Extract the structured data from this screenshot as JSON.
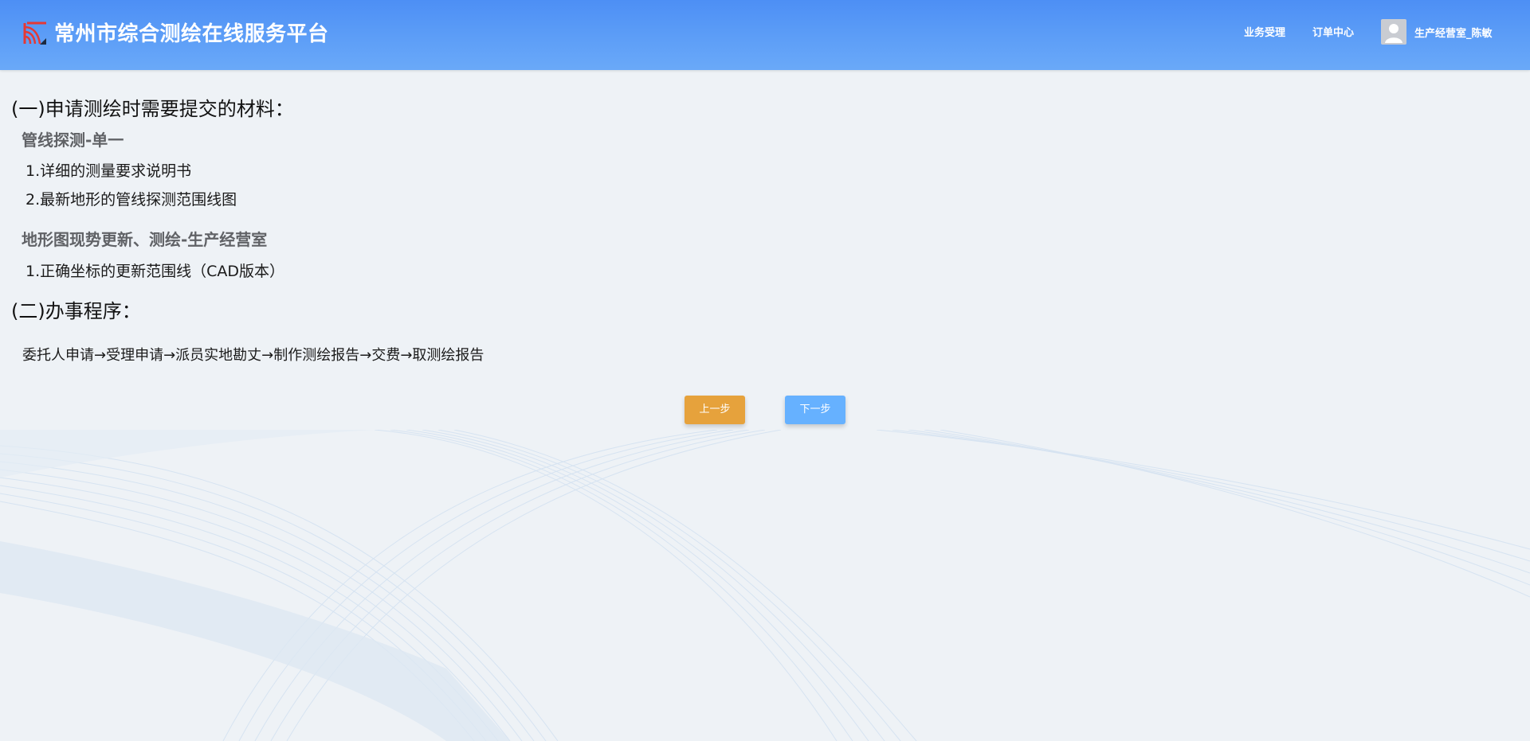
{
  "header": {
    "site_title": "常州市综合测绘在线服务平台",
    "nav": {
      "business": "业务受理",
      "orders": "订单中心"
    },
    "user_name": "生产经营室_陈敏"
  },
  "main": {
    "materials_heading": "(一)申请测绘时需要提交的材料：",
    "categories": [
      {
        "title": "管线探测-单一",
        "items": [
          "1.详细的测量要求说明书",
          "2.最新地形的管线探测范围线图"
        ]
      },
      {
        "title": "地形图现势更新、测绘-生产经营室",
        "items": [
          "1.正确坐标的更新范围线（CAD版本）"
        ]
      }
    ],
    "procedure_heading": "(二)办事程序：",
    "procedure_text": "委托人申请→受理申请→派员实地勘丈→制作测绘报告→交费→取测绘报告"
  },
  "actions": {
    "prev_label": "上一步",
    "next_label": "下一步"
  },
  "colors": {
    "header": "#5d9ef7",
    "prev_button": "#e6a23c",
    "next_button": "#66b1ff",
    "background": "#eef2f6",
    "category_text": "#606266"
  },
  "icons": {
    "logo": "logo-icon",
    "avatar": "user-avatar-icon"
  }
}
